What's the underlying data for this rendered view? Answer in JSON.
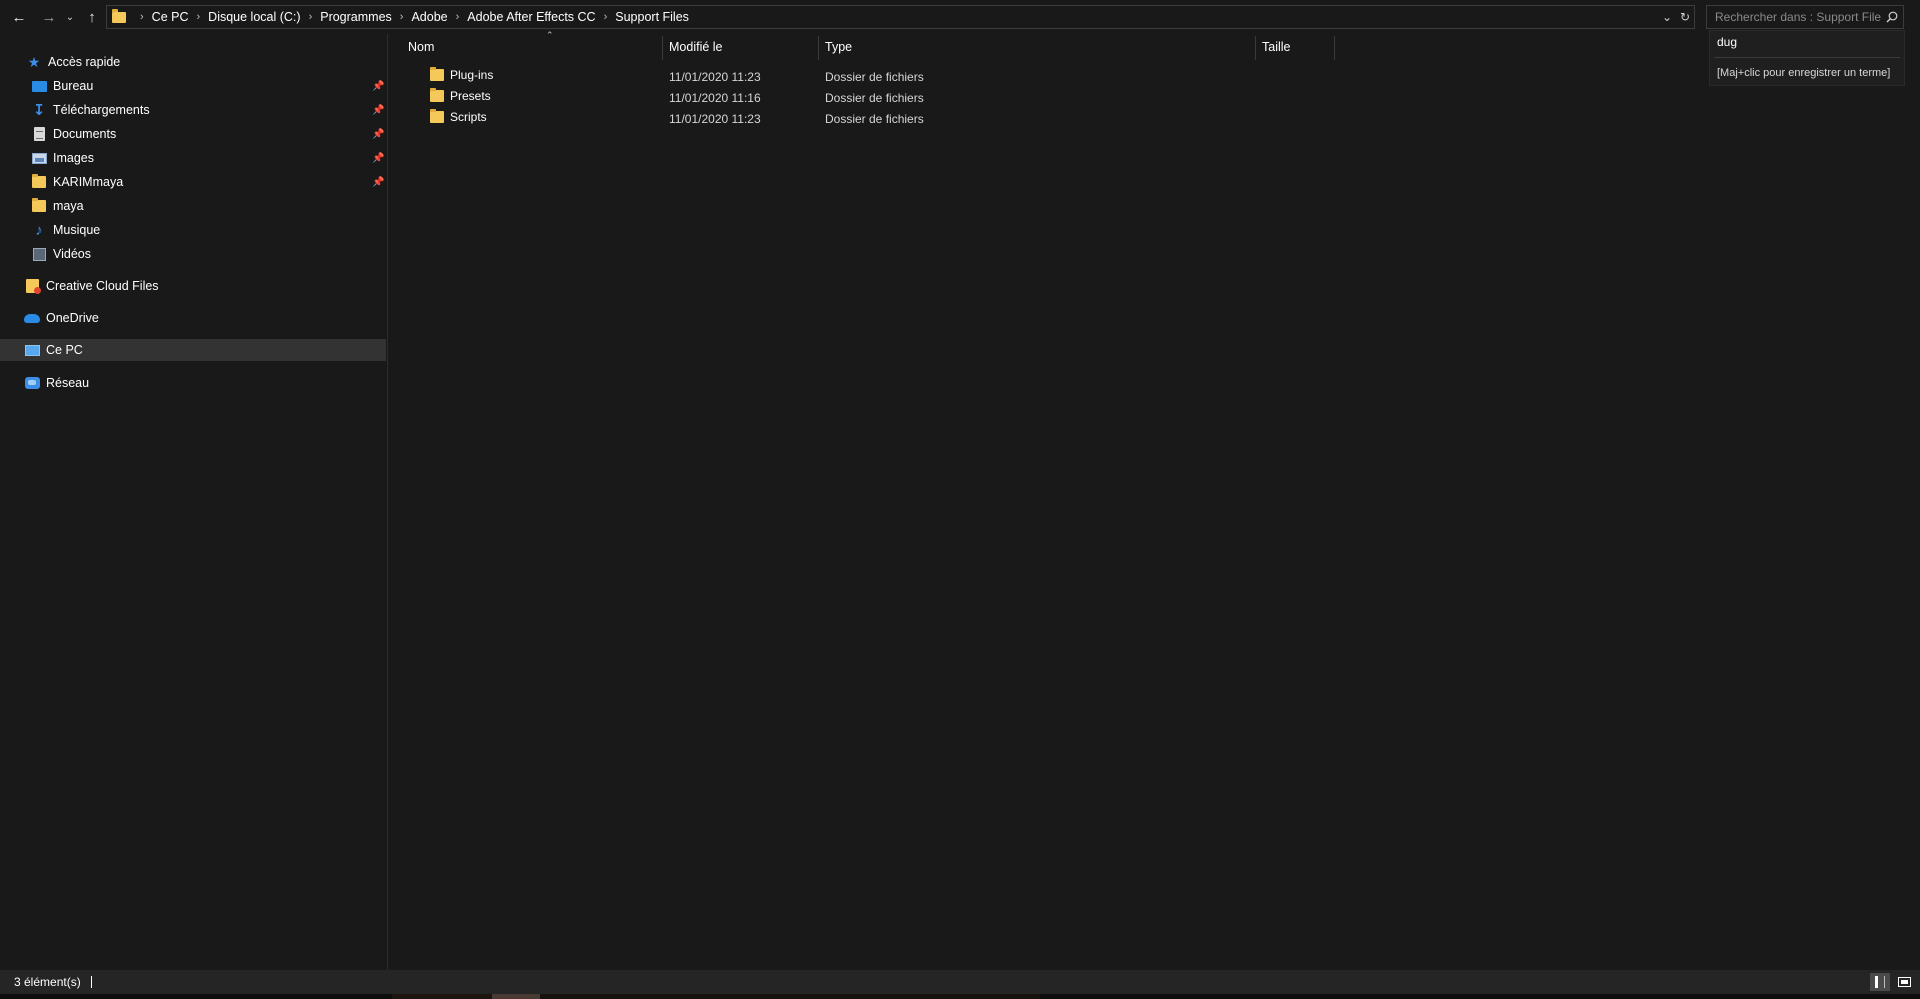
{
  "search": {
    "placeholder": "Rechercher dans : Support Files",
    "value": "",
    "suggestion": "dug",
    "hint": "[Maj+clic pour enregistrer un terme]"
  },
  "breadcrumbs": [
    "Ce PC",
    "Disque local (C:)",
    "Programmes",
    "Adobe",
    "Adobe After Effects CC",
    "Support Files"
  ],
  "sidebar": {
    "quick_access": "Accès rapide",
    "items": [
      {
        "label": "Bureau",
        "icon": "desktop-icon",
        "pinned": true
      },
      {
        "label": "Téléchargements",
        "icon": "download-icon",
        "pinned": true
      },
      {
        "label": "Documents",
        "icon": "documents-icon",
        "pinned": true
      },
      {
        "label": "Images",
        "icon": "images-icon",
        "pinned": true
      },
      {
        "label": "KARIMmaya",
        "icon": "folder-icon",
        "pinned": true
      },
      {
        "label": "maya",
        "icon": "folder-icon",
        "pinned": false
      },
      {
        "label": "Musique",
        "icon": "music-icon",
        "pinned": false
      },
      {
        "label": "Vidéos",
        "icon": "videos-icon",
        "pinned": false
      }
    ],
    "creative_cloud": "Creative Cloud Files",
    "onedrive": "OneDrive",
    "this_pc": "Ce PC",
    "network": "Réseau"
  },
  "columns": {
    "name": "Nom",
    "modified": "Modifié le",
    "type": "Type",
    "size": "Taille"
  },
  "files": [
    {
      "name": "Plug-ins",
      "modified": "11/01/2020 11:23",
      "type": "Dossier de fichiers"
    },
    {
      "name": "Presets",
      "modified": "11/01/2020 11:16",
      "type": "Dossier de fichiers"
    },
    {
      "name": "Scripts",
      "modified": "11/01/2020 11:23",
      "type": "Dossier de fichiers"
    }
  ],
  "status": {
    "count": "3 élément(s)"
  },
  "colors": {
    "background": "#191919",
    "selected": "#333333",
    "folder": "#f5c85a",
    "accent": "#3d8ee6"
  }
}
